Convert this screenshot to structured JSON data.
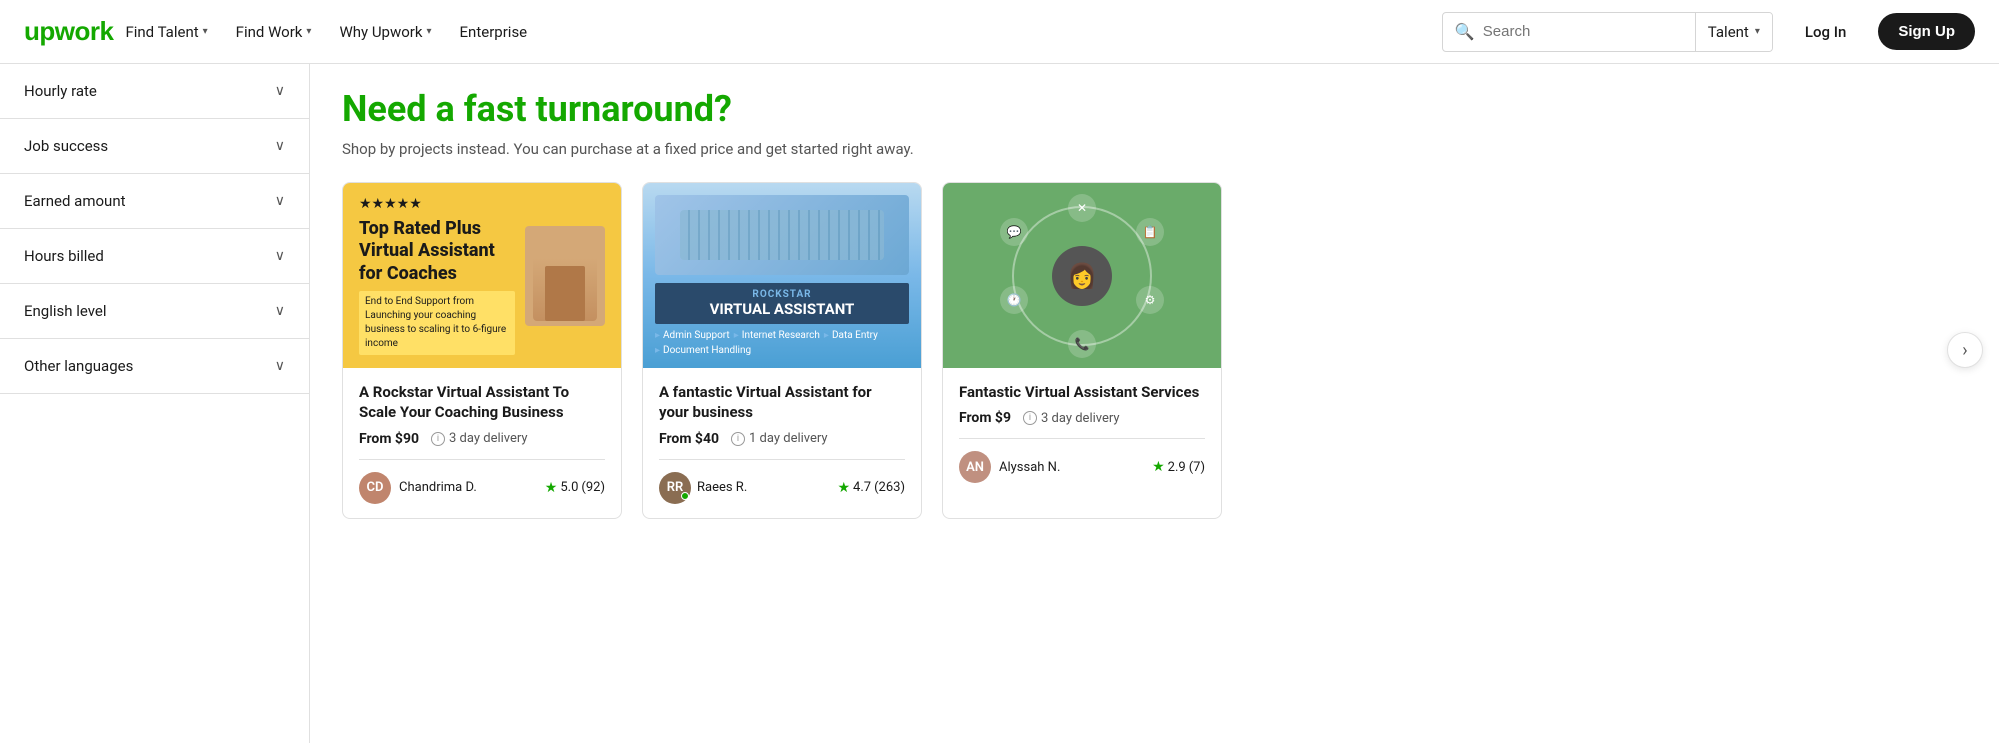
{
  "header": {
    "logo": "upwork",
    "nav": [
      {
        "label": "Find Talent",
        "has_dropdown": true
      },
      {
        "label": "Find Work",
        "has_dropdown": true
      },
      {
        "label": "Why Upwork",
        "has_dropdown": true
      },
      {
        "label": "Enterprise",
        "has_dropdown": false
      }
    ],
    "search": {
      "placeholder": "Search",
      "dropdown_label": "Talent"
    },
    "login_label": "Log In",
    "signup_label": "Sign Up"
  },
  "sidebar": {
    "filters": [
      {
        "label": "Hourly rate",
        "expanded": false
      },
      {
        "label": "Job success",
        "expanded": false
      },
      {
        "label": "Earned amount",
        "expanded": false
      },
      {
        "label": "Hours billed",
        "expanded": false
      },
      {
        "label": "English level",
        "expanded": false
      },
      {
        "label": "Other languages",
        "expanded": false
      }
    ]
  },
  "content": {
    "promo_title": "Need a fast turnaround?",
    "promo_subtitle": "Shop by projects instead. You can purchase at a fixed price and get started right away.",
    "cards": [
      {
        "id": 1,
        "stars": "★★★★★",
        "image_label": "Top Rated Plus Virtual Assistant for Coaches",
        "image_sublabel": "End to End Support from Launching your coaching business to scaling it to 6-figure income",
        "title": "A Rockstar Virtual Assistant To Scale Your Coaching Business",
        "price": "From $90",
        "delivery": "3 day delivery",
        "seller_name": "Chandrima D.",
        "rating": "5.0",
        "reviews": "(92)"
      },
      {
        "id": 2,
        "badge_sub": "Rockstar",
        "badge_title": "VIRTUAL ASSISTANT",
        "tags": [
          "Admin Support",
          "Internet Research",
          "Data Entry",
          "Document Handling"
        ],
        "title": "A fantastic Virtual Assistant for your business",
        "price": "From $40",
        "delivery": "1 day delivery",
        "seller_name": "Raees R.",
        "rating": "4.7",
        "reviews": "(263)",
        "online": true
      },
      {
        "id": 3,
        "title": "Fantastic Virtual Assistant Services",
        "price": "From $9",
        "delivery": "3 day delivery",
        "seller_name": "Alyssah N.",
        "rating": "2.9",
        "reviews": "(7)"
      }
    ],
    "carousel_arrow": "›"
  }
}
